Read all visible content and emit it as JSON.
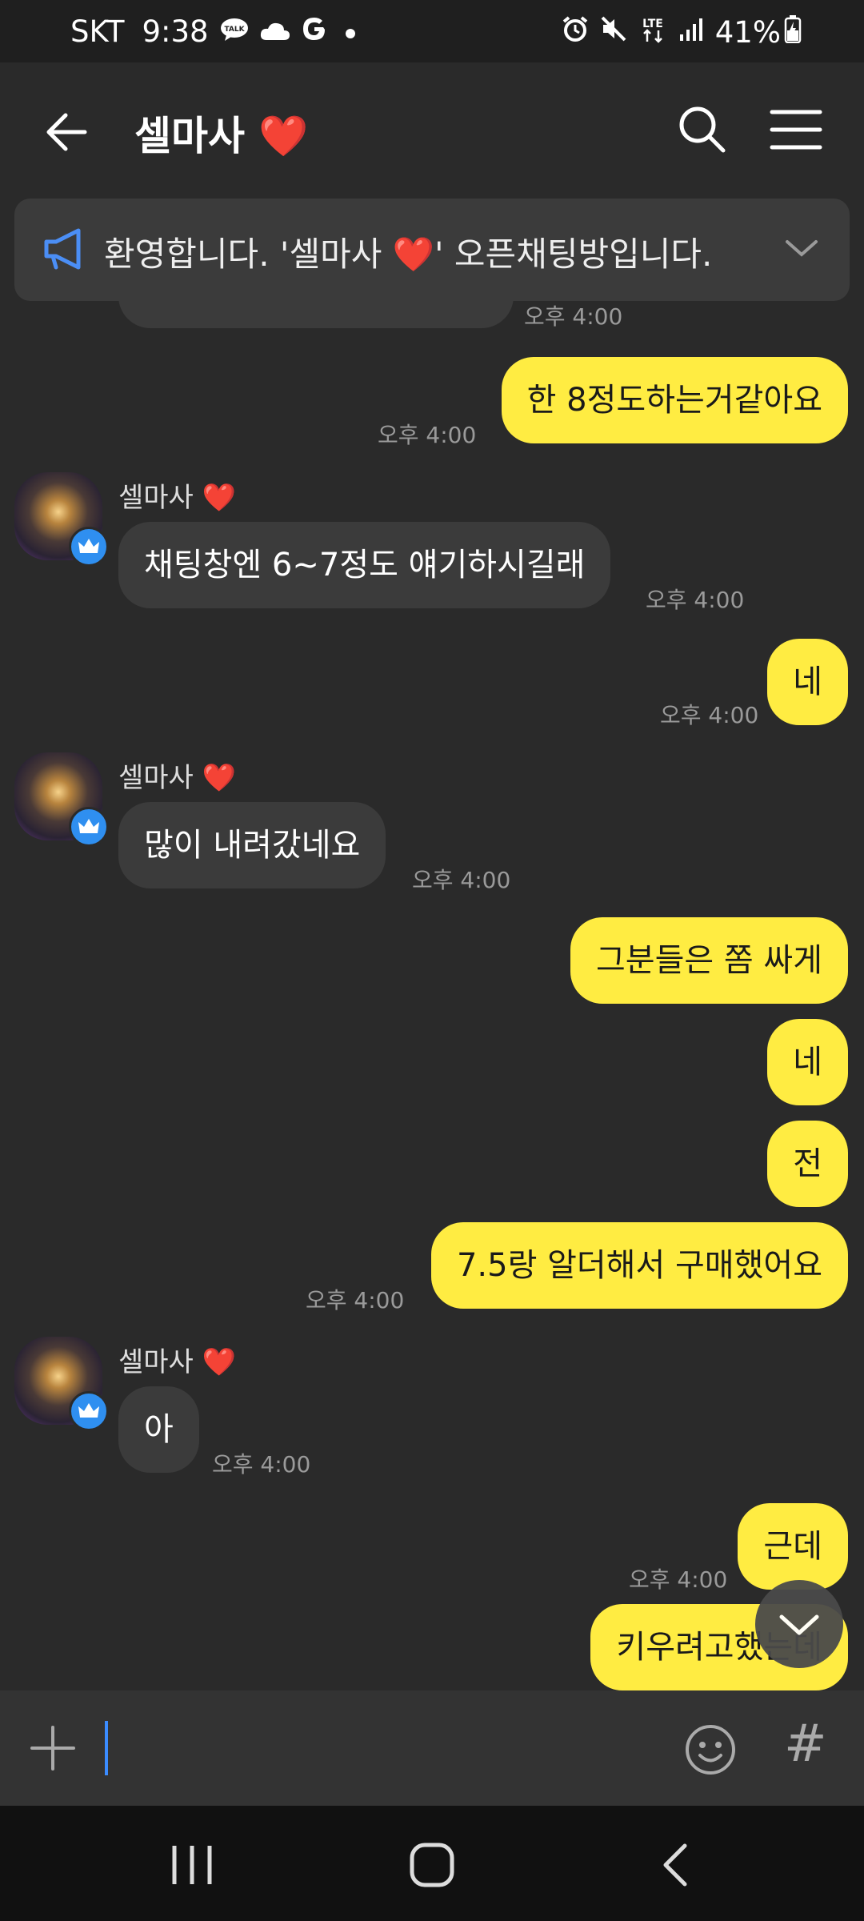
{
  "status_bar": {
    "carrier": "SKT",
    "time": "9:38",
    "notif_icons": [
      "talk-icon",
      "cloud-icon",
      "google-icon",
      "dot-icon"
    ],
    "right_icons": [
      "alarm-icon",
      "mute-icon",
      "lte-icon",
      "signal-icon"
    ],
    "lte_label": "LTE",
    "battery": "41%"
  },
  "header": {
    "title": "셀마사 ❤️"
  },
  "notice": {
    "text": "환영합니다. '셀마사 ❤️' 오픈채팅방입니다."
  },
  "messages": [
    {
      "id": "m0",
      "sender": "other",
      "time": "오후 4:00",
      "partial": true
    },
    {
      "id": "m1",
      "sender": "me",
      "text": "한 8정도하는거같아요",
      "time": "오후 4:00"
    },
    {
      "id": "m2",
      "sender": "other",
      "name": "셀마사 ❤️",
      "text": "채팅창엔 6~7정도 얘기하시길래",
      "time": "오후 4:00"
    },
    {
      "id": "m3",
      "sender": "me",
      "text": "네",
      "time": "오후 4:00"
    },
    {
      "id": "m4",
      "sender": "other",
      "name": "셀마사 ❤️",
      "text": "많이 내려갔네요",
      "time": "오후 4:00"
    },
    {
      "id": "m5",
      "sender": "me",
      "text": "그분들은 쫌 싸게"
    },
    {
      "id": "m6",
      "sender": "me",
      "text": "네"
    },
    {
      "id": "m7",
      "sender": "me",
      "text": "전"
    },
    {
      "id": "m8",
      "sender": "me",
      "text": "7.5랑 알더해서 구매했어요",
      "time": "오후 4:00"
    },
    {
      "id": "m9",
      "sender": "other",
      "name": "셀마사 ❤️",
      "text": "아",
      "time": "오후 4:00"
    },
    {
      "id": "m10",
      "sender": "me",
      "text": "근데",
      "time": "오후 4:00"
    },
    {
      "id": "m11",
      "sender": "me",
      "text": "키우려고했는데"
    }
  ],
  "input": {
    "placeholder": "",
    "hash_label": "#"
  },
  "colors": {
    "background": "#2a2a2a",
    "my_bubble": "#ffec42",
    "other_bubble": "#3b3b3b",
    "accent": "#3b8cff",
    "heart": "#e51c2c"
  }
}
